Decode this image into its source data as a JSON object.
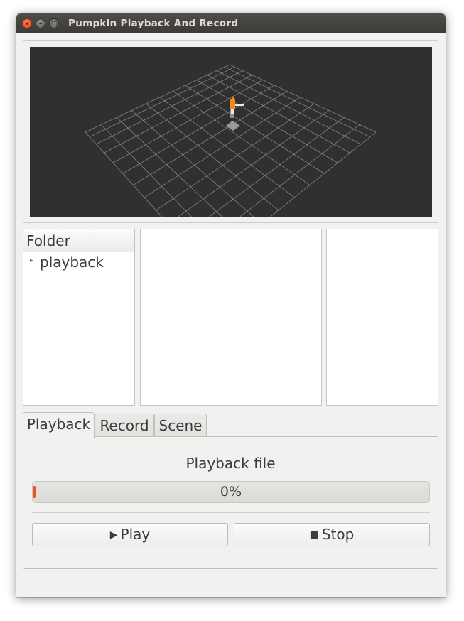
{
  "window": {
    "title": "Pumpkin Playback And Record",
    "controls": {
      "close": "×",
      "minimize": "–",
      "maximize": "□"
    }
  },
  "viewport": {
    "background": "#303030",
    "grid_color": "#a0a0a0",
    "robot_color": "#f08a1c"
  },
  "folder_panel": {
    "header": "Folder",
    "items": [
      {
        "arrow": "▸",
        "label": "playback"
      }
    ]
  },
  "tabs": [
    {
      "label": "Playback",
      "active": true
    },
    {
      "label": "Record",
      "active": false
    },
    {
      "label": "Scene",
      "active": false
    }
  ],
  "playback": {
    "file_label": "Playback file",
    "progress_value": 0,
    "progress_text": "0%",
    "play_glyph": "▶",
    "play_label": "Play",
    "stop_glyph": "■",
    "stop_label": "Stop",
    "accent_color": "#e95420"
  }
}
